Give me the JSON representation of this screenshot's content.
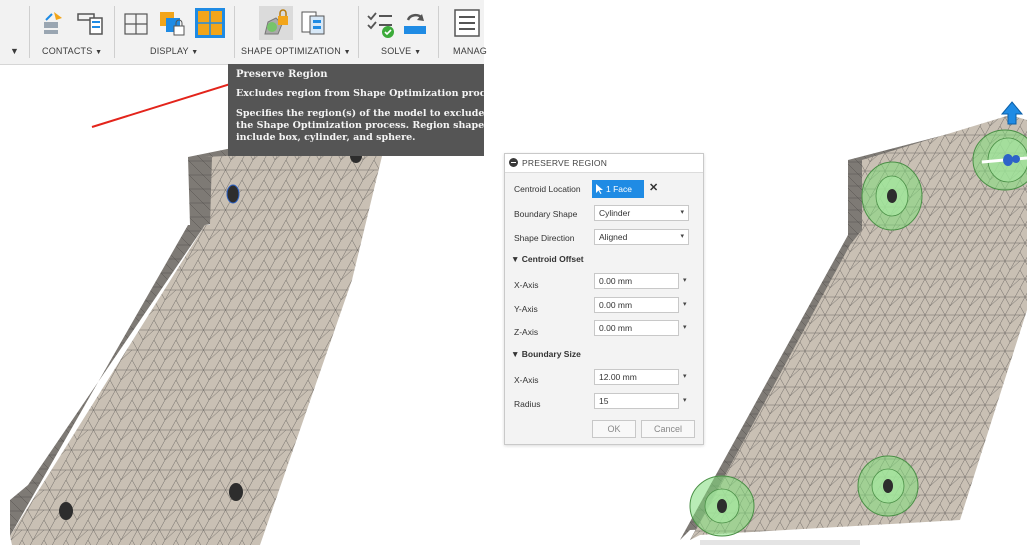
{
  "toolbar": {
    "contacts_label": "CONTACTS",
    "display_label": "DISPLAY",
    "shape_optimization_label": "SHAPE OPTIMIZATION",
    "solve_label": "SOLVE",
    "manage_label": "MANAG",
    "caret": "▼"
  },
  "tooltip": {
    "title": "Preserve Region",
    "subtitle": "Excludes region from Shape Optimization process.",
    "description": "Specifies the region(s) of the model to exclude from the Shape Optimization process. Region shapes include box, cylinder, and sphere."
  },
  "dialog": {
    "title": "PRESERVE REGION",
    "centroid_location": {
      "label": "Centroid Location",
      "selection": "1 Face",
      "clear_symbol": "✕"
    },
    "boundary_shape": {
      "label": "Boundary Shape",
      "value": "Cylinder"
    },
    "shape_direction": {
      "label": "Shape Direction",
      "value": "Aligned"
    },
    "centroid_offset": {
      "heading": "▼ Centroid Offset",
      "x_label": "X-Axis",
      "x_value": "0.00 mm",
      "y_label": "Y-Axis",
      "y_value": "0.00 mm",
      "z_label": "Z-Axis",
      "z_value": "0.00 mm"
    },
    "boundary_size": {
      "heading": "▼ Boundary Size",
      "x_label": "X-Axis",
      "x_value": "12.00 mm",
      "radius_label": "Radius",
      "radius_value": "15"
    },
    "ok_label": "OK",
    "cancel_label": "Cancel",
    "dropdown_caret": "▾"
  },
  "colors": {
    "toolbar_bg": "#f2f2f2",
    "tooltip_bg": "#555555",
    "accent_blue": "#1f8be4",
    "mesh_fill": "#c9c0b4",
    "mesh_line": "#6e6a66",
    "preserve_green": "#7fdc7a",
    "annotation_arrow": "#e3241b"
  }
}
